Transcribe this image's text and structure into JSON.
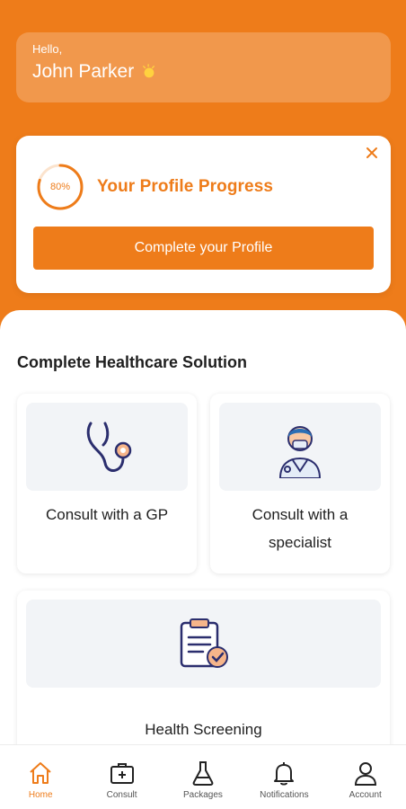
{
  "greeting": {
    "hello": "Hello,",
    "name": "John Parker"
  },
  "profile_progress": {
    "percent_label": "80%",
    "percent_value": 0.8,
    "title": "Your Profile Progress",
    "button_label": "Complete your Profile"
  },
  "section": {
    "title": "Complete Healthcare Solution"
  },
  "services": [
    {
      "label": "Consult with a GP",
      "icon": "stethoscope-icon"
    },
    {
      "label_line1": "Consult with a",
      "label_line2": "specialist",
      "icon": "doctor-icon"
    },
    {
      "label": "Health Screening",
      "icon": "clipboard-check-icon"
    }
  ],
  "nav": [
    {
      "label": "Home",
      "icon": "home-icon",
      "active": true
    },
    {
      "label": "Consult",
      "icon": "medical-kit-icon"
    },
    {
      "label": "Packages",
      "icon": "flask-icon"
    },
    {
      "label": "Notifications",
      "icon": "bell-icon"
    },
    {
      "label": "Account",
      "icon": "user-icon"
    }
  ],
  "colors": {
    "brand": "#EE7C1A",
    "icon_navy": "#2B2E6E",
    "card_bg": "#F2F4F7"
  }
}
